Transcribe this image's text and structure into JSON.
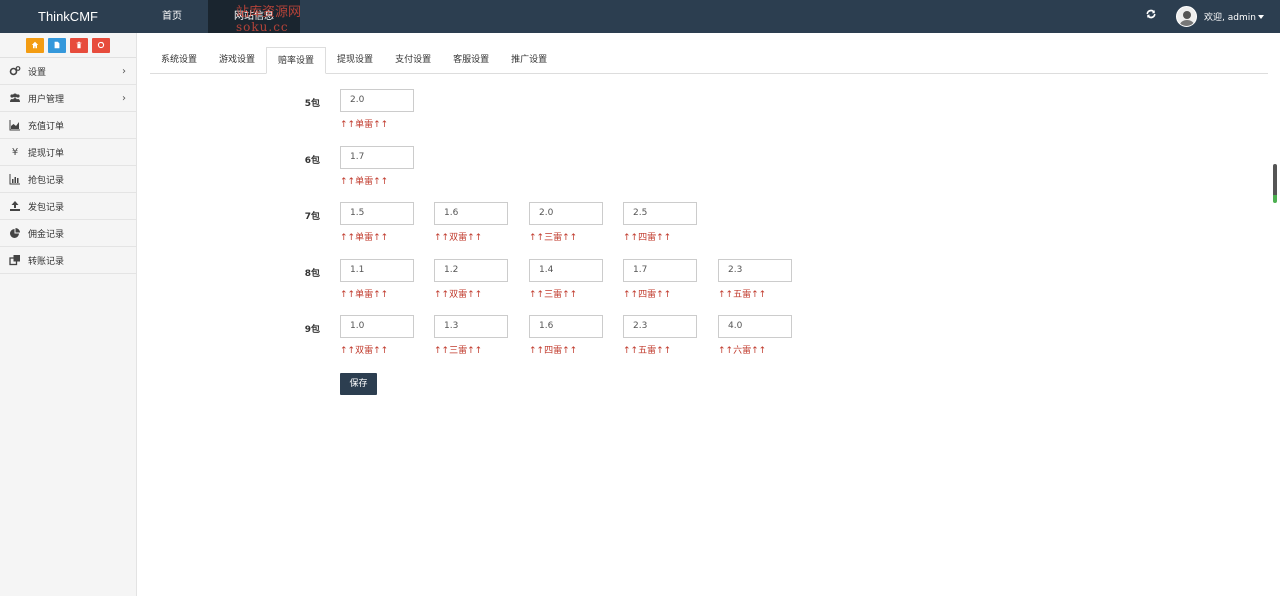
{
  "navbar": {
    "brand": "ThinkCMF",
    "items": [
      {
        "label": "首页"
      },
      {
        "label": "网站信息"
      }
    ],
    "watermark_line1": "站库资源网",
    "watermark_line2": "soku.cc",
    "user_label": "欢迎, admin"
  },
  "quick_buttons": [
    {
      "icon": "home-icon",
      "color": "#f39c12"
    },
    {
      "icon": "file-icon",
      "color": "#3498db"
    },
    {
      "icon": "trash-icon",
      "color": "#e74c3c"
    },
    {
      "icon": "recycle-icon",
      "color": "#e74c3c"
    }
  ],
  "sidebar": {
    "items": [
      {
        "label": "设置",
        "icon": "gears-icon",
        "has_arrow": true
      },
      {
        "label": "用户管理",
        "icon": "users-icon",
        "has_arrow": true
      },
      {
        "label": "充值订单",
        "icon": "area-chart-icon",
        "has_arrow": false
      },
      {
        "label": "提现订单",
        "icon": "yen-icon",
        "has_arrow": false
      },
      {
        "label": "抢包记录",
        "icon": "bar-chart-icon",
        "has_arrow": false
      },
      {
        "label": "发包记录",
        "icon": "upload-icon",
        "has_arrow": false
      },
      {
        "label": "佣金记录",
        "icon": "pie-chart-icon",
        "has_arrow": false
      },
      {
        "label": "转账记录",
        "icon": "clone-icon",
        "has_arrow": false
      }
    ]
  },
  "tabs": [
    {
      "label": "系统设置"
    },
    {
      "label": "游戏设置"
    },
    {
      "label": "赔率设置"
    },
    {
      "label": "提现设置"
    },
    {
      "label": "支付设置"
    },
    {
      "label": "客服设置"
    },
    {
      "label": "推广设置"
    }
  ],
  "active_tab": 2,
  "rows": [
    {
      "label": "5包",
      "fields": [
        {
          "value": "2.0",
          "hint": "↑↑单雷↑↑"
        }
      ]
    },
    {
      "label": "6包",
      "fields": [
        {
          "value": "1.7",
          "hint": "↑↑单雷↑↑"
        }
      ]
    },
    {
      "label": "7包",
      "fields": [
        {
          "value": "1.5",
          "hint": "↑↑单雷↑↑"
        },
        {
          "value": "1.6",
          "hint": "↑↑双雷↑↑"
        },
        {
          "value": "2.0",
          "hint": "↑↑三雷↑↑"
        },
        {
          "value": "2.5",
          "hint": "↑↑四雷↑↑"
        }
      ]
    },
    {
      "label": "8包",
      "fields": [
        {
          "value": "1.1",
          "hint": "↑↑单雷↑↑"
        },
        {
          "value": "1.2",
          "hint": "↑↑双雷↑↑"
        },
        {
          "value": "1.4",
          "hint": "↑↑三雷↑↑"
        },
        {
          "value": "1.7",
          "hint": "↑↑四雷↑↑"
        },
        {
          "value": "2.3",
          "hint": "↑↑五雷↑↑"
        }
      ]
    },
    {
      "label": "9包",
      "fields": [
        {
          "value": "1.0",
          "hint": "↑↑双雷↑↑"
        },
        {
          "value": "1.3",
          "hint": "↑↑三雷↑↑"
        },
        {
          "value": "1.6",
          "hint": "↑↑四雷↑↑"
        },
        {
          "value": "2.3",
          "hint": "↑↑五雷↑↑"
        },
        {
          "value": "4.0",
          "hint": "↑↑六雷↑↑"
        }
      ]
    }
  ],
  "save_label": "保存"
}
